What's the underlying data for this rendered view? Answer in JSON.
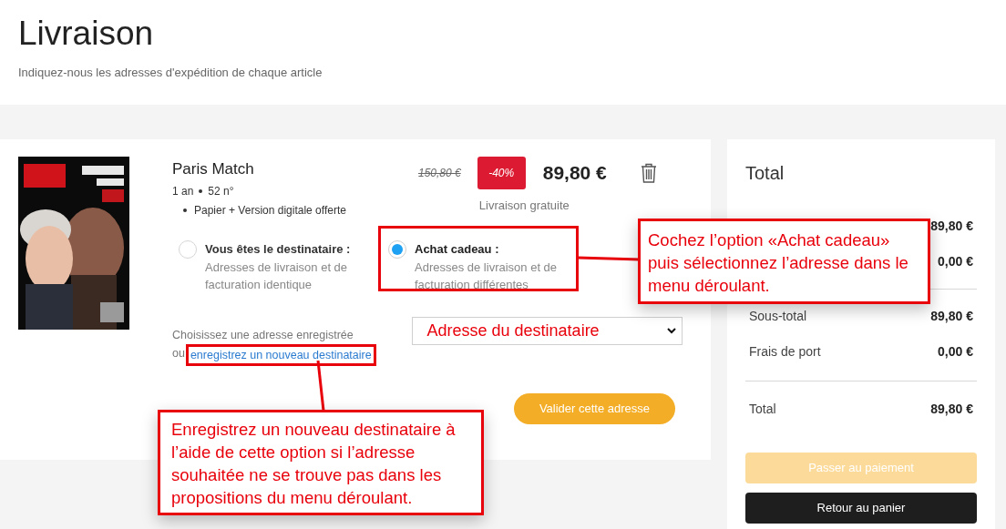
{
  "page": {
    "title": "Livraison",
    "subtitle": "Indiquez-nous les adresses d'expédition de chaque article"
  },
  "item": {
    "cover": {
      "kind": "picture"
    },
    "name": "Paris Match",
    "term": "1 an",
    "issues": "52 n°",
    "features": [
      "Papier + Version digitale offerte"
    ],
    "old_price": "150,80 €",
    "discount": "-40%",
    "price": "89,80 €",
    "shipping": "Livraison gratuite"
  },
  "recipient_options": [
    {
      "title": "Vous êtes le destinataire :",
      "description": "Adresses de livraison et de facturation identique",
      "selected": false
    },
    {
      "title": "Achat cadeau :",
      "description": "Adresses de livraison et de facturation différentes",
      "selected": true
    }
  ],
  "address": {
    "prompt": "Choisissez une adresse enregistrée",
    "prefix": "ou",
    "link": "enregistrez un nouveau destinataire",
    "select_value": "Adresse du destinataire"
  },
  "validate_button": "Valider cette adresse",
  "summary": {
    "title": "Total",
    "groups": [
      [
        {
          "value": "89,80 €"
        },
        {
          "value": "0,00 €"
        }
      ],
      [
        {
          "label": "Sous-total",
          "value": "89,80 €"
        },
        {
          "label": "Frais de port",
          "value": "0,00 €"
        }
      ]
    ],
    "total_label": "Total",
    "total_value": "89,80 €",
    "buttons": [
      {
        "label": "Passer au paiement",
        "disabled": true
      },
      {
        "label": "Retour au panier",
        "disabled": false
      }
    ]
  },
  "callouts": [
    {
      "text": "Cochez l’option «Achat cadeau» puis sélectionnez l’adresse dans le menu déroulant."
    },
    {
      "text": "Enregistrez un nouveau destinataire à l’aide de cette option si l’adresse souhaitée ne se trouve pas dans les propositions du menu déroulant."
    }
  ]
}
